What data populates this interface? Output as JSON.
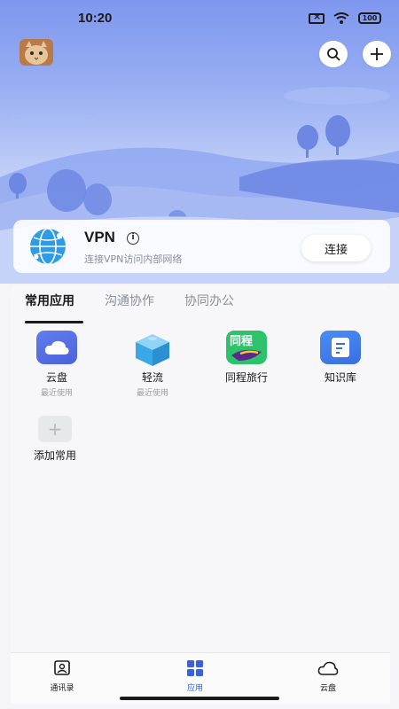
{
  "status_bar": {
    "time": "10:20",
    "battery": "100"
  },
  "vpn": {
    "title": "VPN",
    "subtitle": "连接VPN访问内部网络",
    "connect_label": "连接"
  },
  "tabs": [
    {
      "label": "常用应用",
      "active": true
    },
    {
      "label": "沟通协作",
      "active": false
    },
    {
      "label": "协同办公",
      "active": false
    }
  ],
  "apps": [
    {
      "label": "云盘",
      "sub": "最近使用",
      "icon": "cloud-icon"
    },
    {
      "label": "轻流",
      "sub": "最近使用",
      "icon": "cube-icon"
    },
    {
      "label": "同程旅行",
      "sub": "",
      "icon": "tongcheng-icon",
      "icon_text": "同程"
    },
    {
      "label": "知识库",
      "sub": "",
      "icon": "document-icon"
    }
  ],
  "add_app": {
    "label": "添加常用",
    "icon": "plus-icon"
  },
  "bottom_nav": [
    {
      "label": "通讯录",
      "icon": "contacts-icon",
      "active": false
    },
    {
      "label": "应用",
      "icon": "grid-icon",
      "active": true
    },
    {
      "label": "云盘",
      "icon": "cloud-outline-icon",
      "active": false
    }
  ],
  "colors": {
    "accent": "#3a5fe0",
    "hero_top": "#7f97ef",
    "green": "#2ec36a"
  }
}
